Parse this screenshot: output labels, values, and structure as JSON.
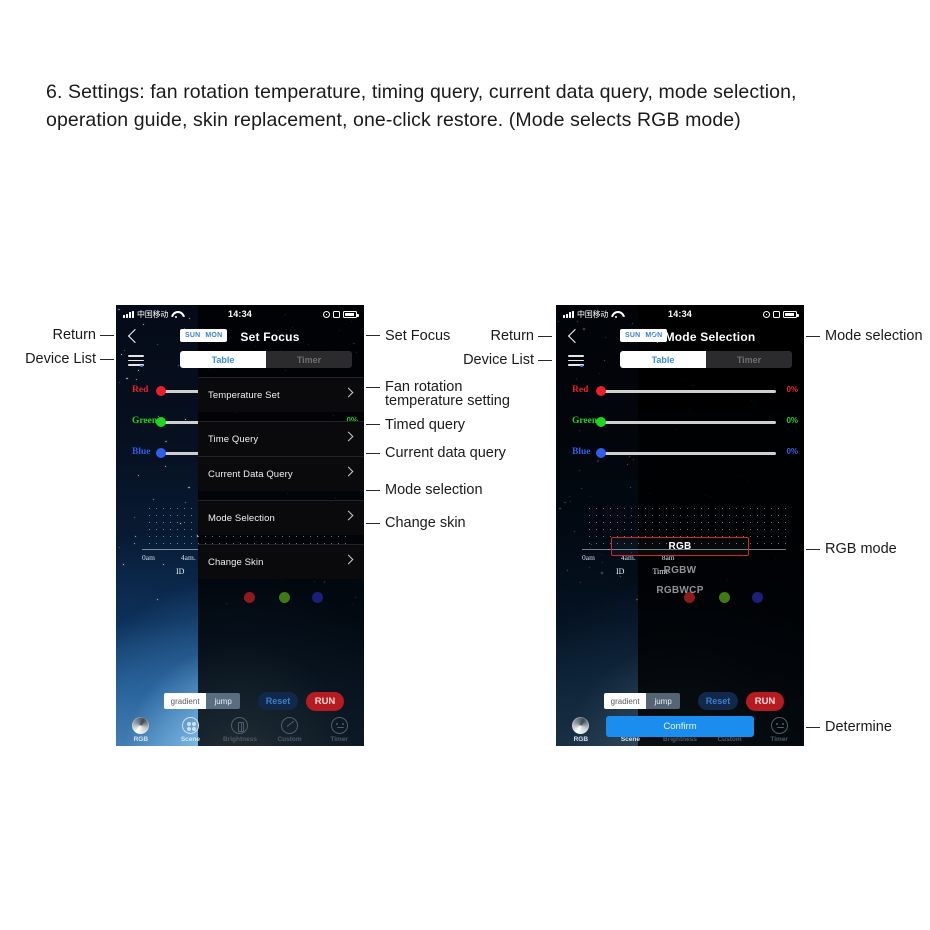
{
  "caption": {
    "line1": "6. Settings: fan rotation temperature, timing query, current data query, mode selection,",
    "line2": "operation guide, skin replacement, one-click restore. (Mode selects RGB mode)"
  },
  "statusbar": {
    "carrier": "中国移动",
    "time": "14:34"
  },
  "day_chip": {
    "day1": "SUN",
    "day2": "MON"
  },
  "segmented": {
    "on": "Table",
    "off": "Timer"
  },
  "sliders": [
    {
      "label": "Red",
      "value": "0%",
      "color": "#e8202a"
    },
    {
      "label": "Green",
      "value": "0%",
      "color": "#1fd61f"
    },
    {
      "label": "Blue",
      "value": "0%",
      "color": "#2f5fe8"
    }
  ],
  "chart": {
    "ticks": [
      "0am",
      "4am.",
      "8am"
    ],
    "headers": [
      "ID",
      "Time"
    ]
  },
  "controls": {
    "gradient": "gradient",
    "jump": "jump",
    "reset": "Reset",
    "run": "RUN"
  },
  "tabbar": [
    {
      "label": "RGB",
      "icon": "rgb-sphere-icon"
    },
    {
      "label": "Scene",
      "icon": "scene-grid-icon"
    },
    {
      "label": "Brightness",
      "icon": "brightness-icon"
    },
    {
      "label": "Custom",
      "icon": "custom-pen-icon"
    },
    {
      "label": "Timer",
      "icon": "timer-face-icon"
    }
  ],
  "left_phone": {
    "nav_title": "Set Focus",
    "menu": [
      {
        "label": "Temperature Set"
      },
      {
        "label": "Time Query"
      },
      {
        "label": "Current Data Query"
      },
      {
        "label": "Mode Selection"
      },
      {
        "label": "Change Skin"
      }
    ]
  },
  "right_phone": {
    "nav_title": "Mode Selection",
    "modes": [
      "RGB",
      "RGBW",
      "RGBWCP"
    ],
    "selected_mode": "RGB",
    "confirm": "Confirm"
  },
  "annotations": {
    "left": {
      "return": "Return",
      "device_list": "Device List"
    },
    "middle": {
      "set_focus": "Set Focus",
      "return": "Return",
      "device_list": "Device List",
      "fan_line1": "Fan rotation",
      "fan_line2": "temperature setting",
      "timed_query": "Timed query",
      "current_data_query": "Current data query",
      "mode_selection": "Mode selection",
      "change_skin": "Change skin"
    },
    "right": {
      "mode_selection": "Mode selection",
      "rgb_mode": "RGB mode",
      "determine": "Determine"
    }
  }
}
